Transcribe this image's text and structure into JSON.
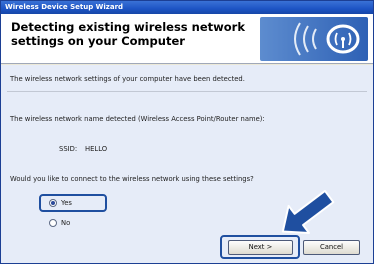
{
  "window": {
    "title": "Wireless Device Setup Wizard"
  },
  "header": {
    "title": "Detecting existing wireless network settings on your Computer"
  },
  "content": {
    "detected_message": "The wireless network settings of your computer have been detected.",
    "network_name_label": "The wireless network name detected (Wireless Access Point/Router name):",
    "ssid_label": "SSID:",
    "ssid_value": "HELLO",
    "question": "Would you like to connect to the wireless network using these settings?"
  },
  "options": {
    "yes_label": "Yes",
    "no_label": "No",
    "selected": "Yes"
  },
  "buttons": {
    "next_label": "Next >",
    "cancel_label": "Cancel"
  },
  "icons": {
    "logo": "wireless-signal-logo-icon",
    "arrow": "pointer-arrow-icon"
  },
  "colors": {
    "titlebar": "#1d54c4",
    "highlight": "#1f4fa0",
    "arrow": "#1f4fa0",
    "body": "#e6ecf8"
  }
}
